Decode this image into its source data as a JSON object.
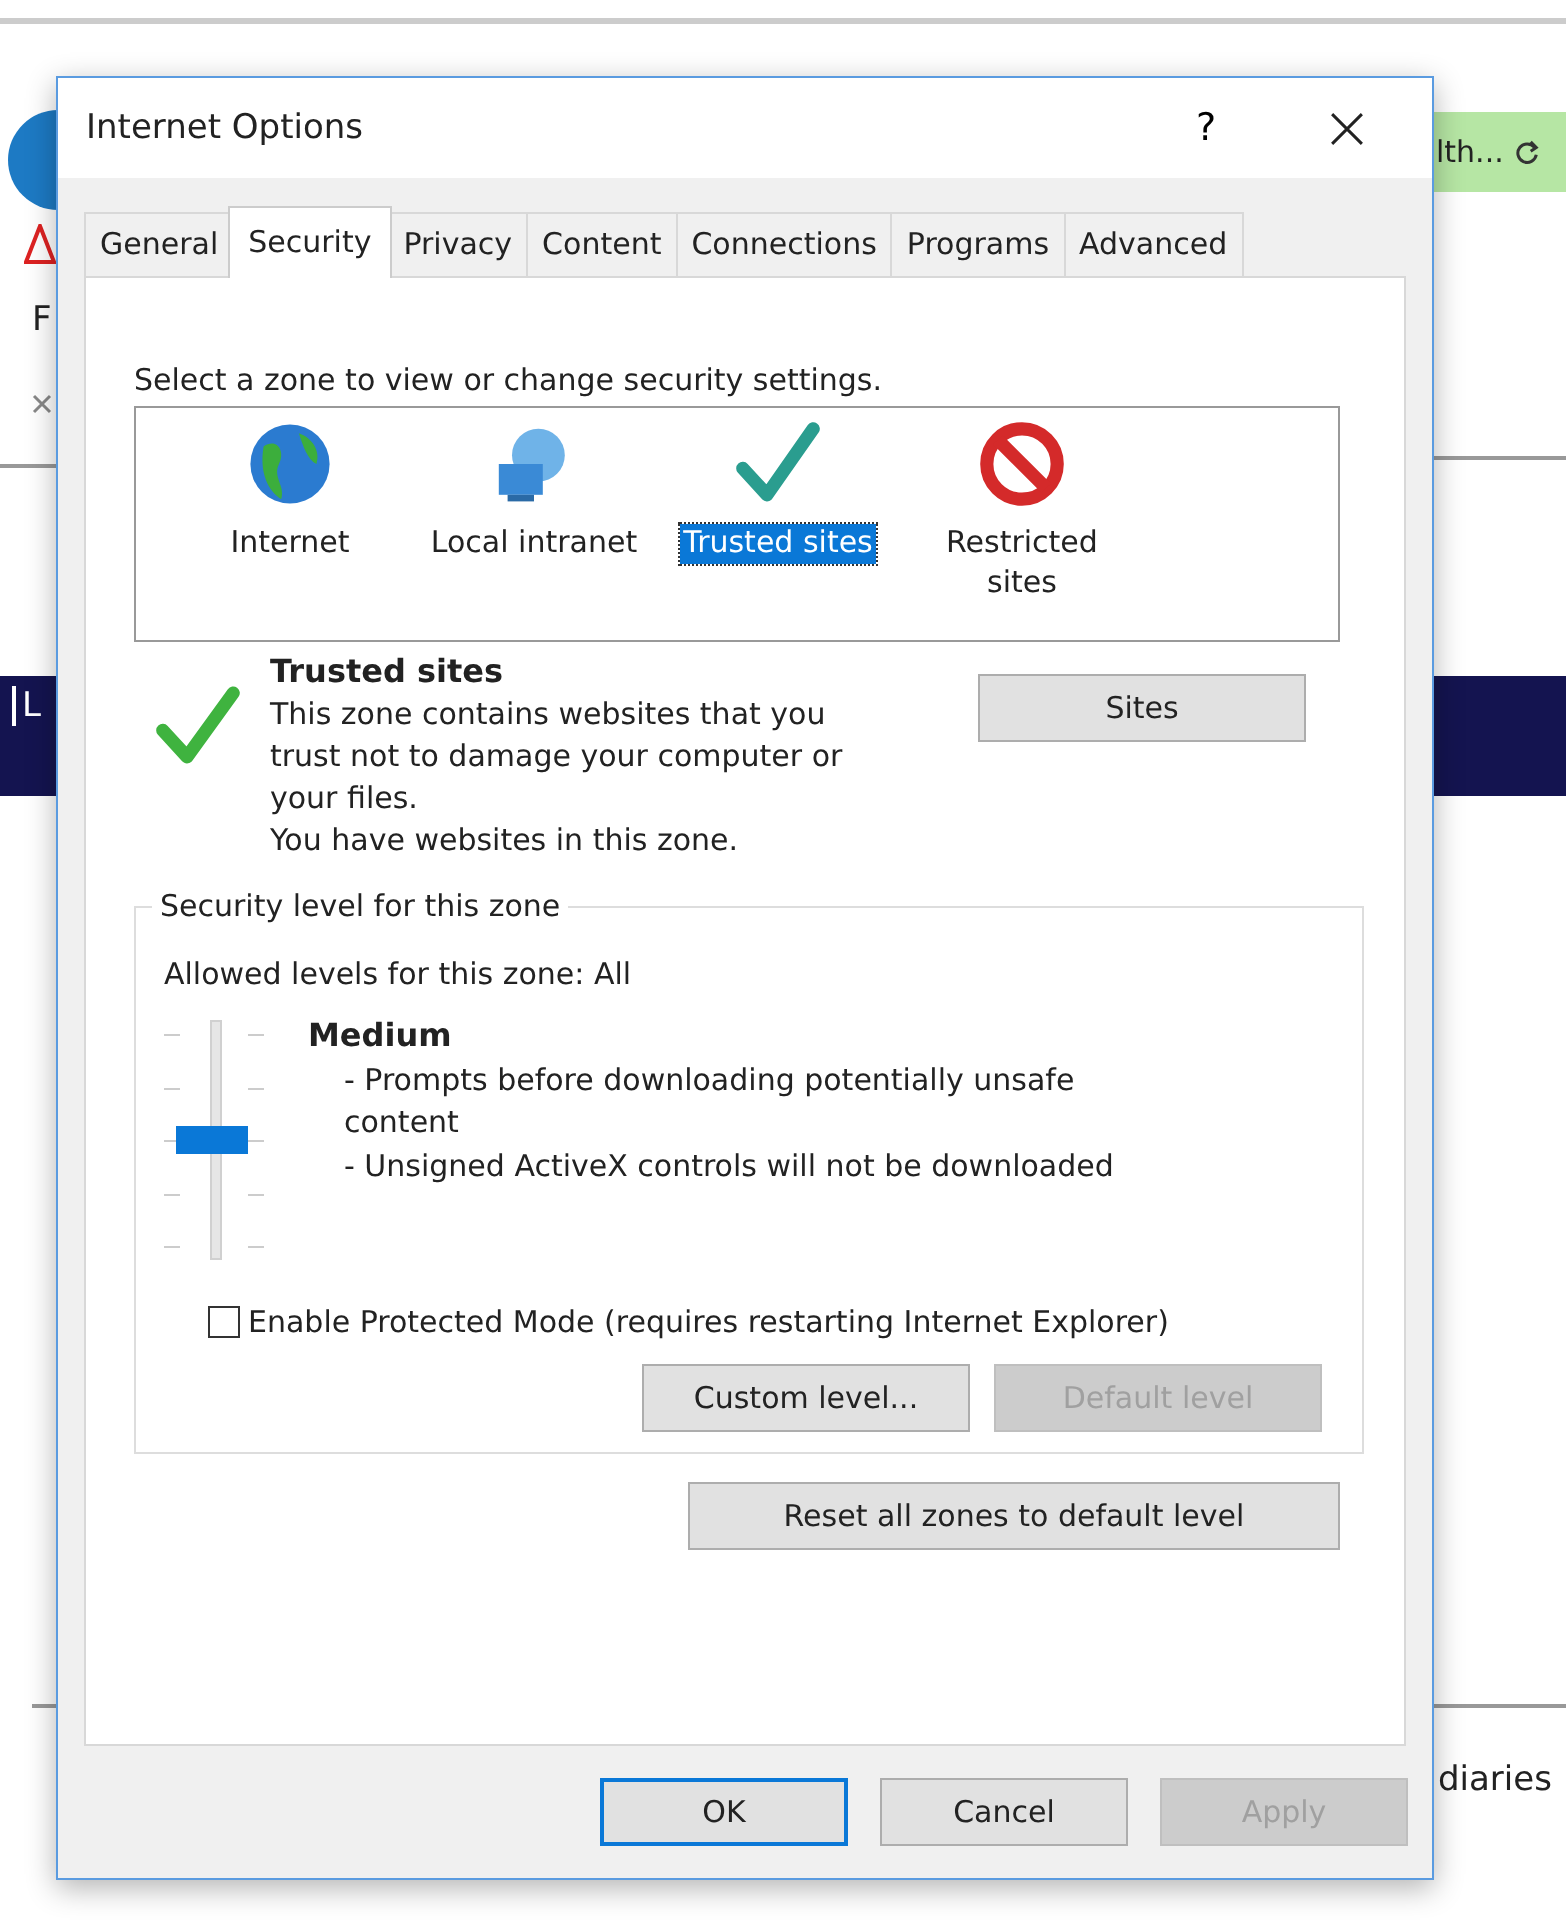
{
  "background": {
    "badge": "lth...",
    "letters": [
      "F",
      "L"
    ],
    "text": "diaries"
  },
  "window": {
    "title": "Internet Options",
    "help": "?"
  },
  "tabs": [
    {
      "label": "General",
      "selected": false
    },
    {
      "label": "Security",
      "selected": true
    },
    {
      "label": "Privacy",
      "selected": false
    },
    {
      "label": "Content",
      "selected": false
    },
    {
      "label": "Connections",
      "selected": false
    },
    {
      "label": "Programs",
      "selected": false
    },
    {
      "label": "Advanced",
      "selected": false
    }
  ],
  "zone_prompt": "Select a zone to view or change security settings.",
  "zones": [
    {
      "label": "Internet",
      "kind": "globe",
      "selected": false
    },
    {
      "label": "Local intranet",
      "kind": "intranet",
      "selected": false
    },
    {
      "label": "Trusted sites",
      "kind": "check",
      "selected": true
    },
    {
      "label": "Restricted sites",
      "kind": "blocked",
      "selected": false
    }
  ],
  "zone_info": {
    "title": "Trusted sites",
    "description": "This zone contains websites that you trust not to damage your computer or your files.",
    "note": "You have websites in this zone.",
    "button": "Sites"
  },
  "security_level": {
    "legend": "Security level for this zone",
    "allowed": "Allowed levels for this zone: All",
    "level": 0.5,
    "level_name": "Medium",
    "points": [
      "- Prompts before downloading potentially unsafe content",
      "- Unsigned ActiveX controls will not be downloaded"
    ],
    "protected_mode": {
      "label": "Enable Protected Mode (requires restarting Internet Explorer)",
      "checked": false
    },
    "buttons": [
      {
        "label": "Custom level...",
        "disabled": false
      },
      {
        "label": "Default level",
        "disabled": true
      }
    ]
  },
  "reset_button": "Reset all zones to default level",
  "footer_buttons": [
    {
      "label": "OK",
      "default": true,
      "disabled": false
    },
    {
      "label": "Cancel",
      "default": false,
      "disabled": false
    },
    {
      "label": "Apply",
      "default": false,
      "disabled": true
    }
  ]
}
